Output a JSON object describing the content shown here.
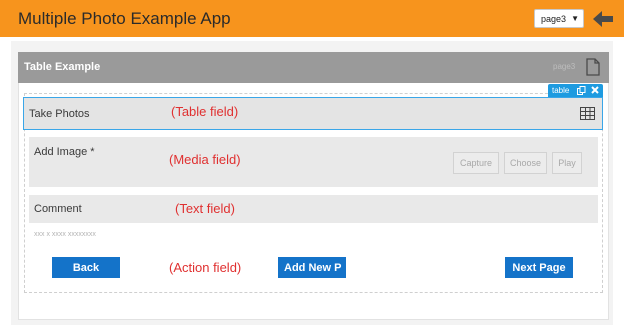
{
  "app": {
    "title": "Multiple Photo Example App"
  },
  "header": {
    "page_select": {
      "value": "page3"
    },
    "back_icon": "back-arrow-icon"
  },
  "section": {
    "title": "Table Example",
    "page_label": "page3",
    "icon": "document-icon"
  },
  "selection_tag": {
    "label": "table",
    "copy_icon": "copy-icon",
    "close_icon": "close-icon"
  },
  "fields": {
    "table": {
      "label": "Take Photos",
      "annotation": "(Table field)",
      "icon": "table-grid-icon"
    },
    "media": {
      "label": "Add Image *",
      "annotation": "(Media field)",
      "buttons": [
        "Capture",
        "Choose",
        "Play"
      ]
    },
    "text": {
      "label": "Comment",
      "annotation": "(Text field)",
      "placeholder": "xxx x xxxx xxxxxxxx"
    },
    "action": {
      "annotation": "(Action field)",
      "back": "Back",
      "add_new": "Add New P",
      "next": "Next Page"
    }
  },
  "colors": {
    "header": "#f7941d",
    "section_bar": "#9a9a9a",
    "action_button": "#1473c9",
    "selection": "#1e9be0",
    "annotation": "#e03030"
  }
}
